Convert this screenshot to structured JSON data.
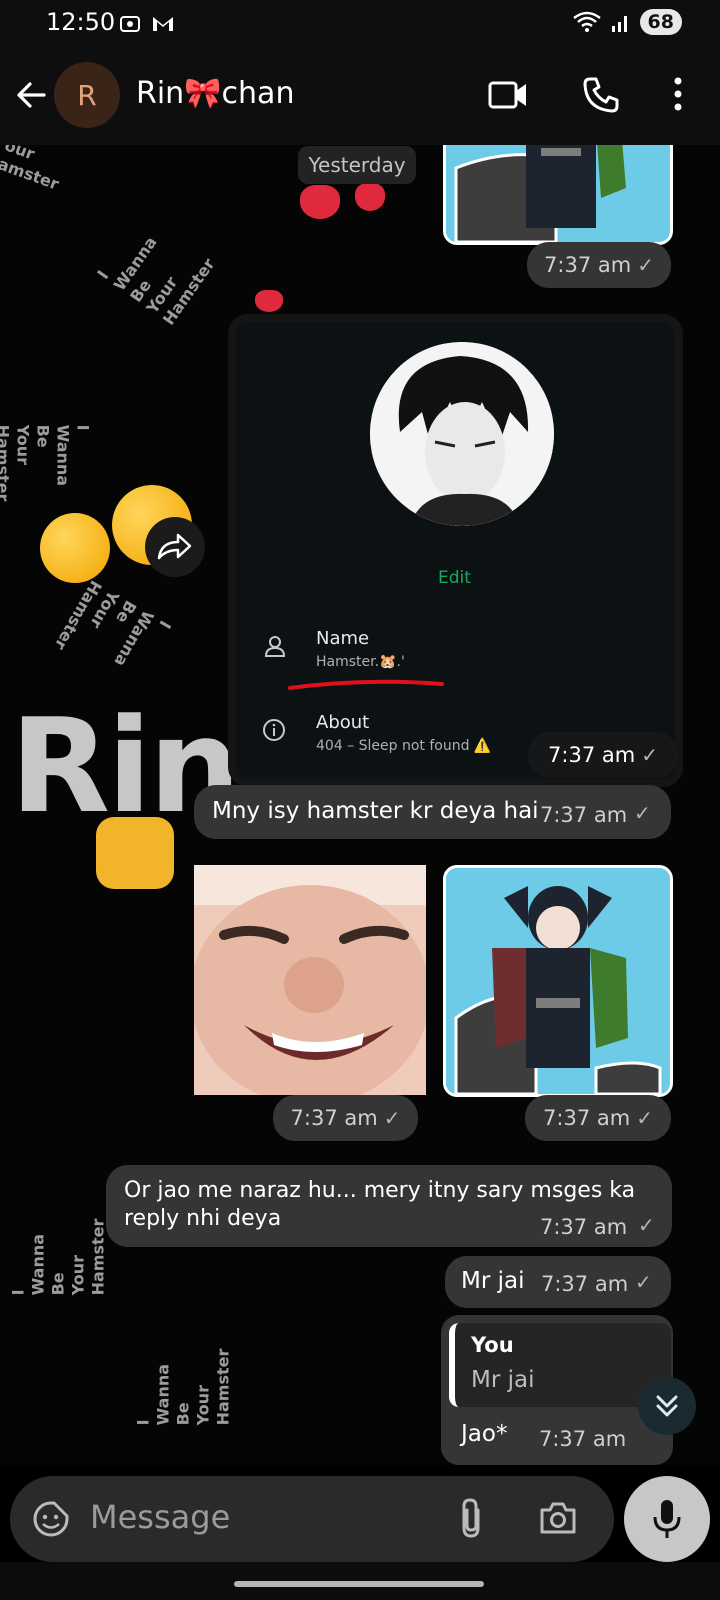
{
  "status_bar": {
    "time": "12:50",
    "battery": "68"
  },
  "header": {
    "avatar_letter": "R",
    "contact_name": "Rin🎀chan"
  },
  "chat": {
    "date_separator": "Yesterday",
    "wallpaper_word": "Rin",
    "wallpaper_phrase": "I\nWanna\nBe\nYour\nHamster",
    "wallpaper_phrase_partial": "our\namster",
    "screenshot": {
      "edit_label": "Edit",
      "name_label": "Name",
      "name_value": "Hamster.🐹.'",
      "about_label": "About",
      "about_value": "404 – Sleep not found ⚠️"
    },
    "messages": [
      {
        "time": "7:37 am"
      },
      {
        "time": "7:37 am"
      },
      {
        "text": "Mny isy hamster kr deya hai",
        "time": "7:37 am"
      },
      {
        "time": "7:37 am"
      },
      {
        "time": "7:37 am"
      },
      {
        "text": "Or jao me naraz hu... mery itny sary msges ka reply nhi deya",
        "time": "7:37 am"
      },
      {
        "text": "Mr jai",
        "time": "7:37 am"
      },
      {
        "reply_author": "You",
        "reply_quote": "Mr jai",
        "text": "Jao*",
        "time": "7:37 am"
      }
    ]
  },
  "composer": {
    "placeholder": "Message"
  },
  "icons": [
    "back-arrow-icon",
    "video-call-icon",
    "voice-call-icon",
    "more-options-icon",
    "forward-icon",
    "scroll-down-icon",
    "sticker-icon",
    "attach-icon",
    "camera-icon",
    "mic-icon"
  ]
}
